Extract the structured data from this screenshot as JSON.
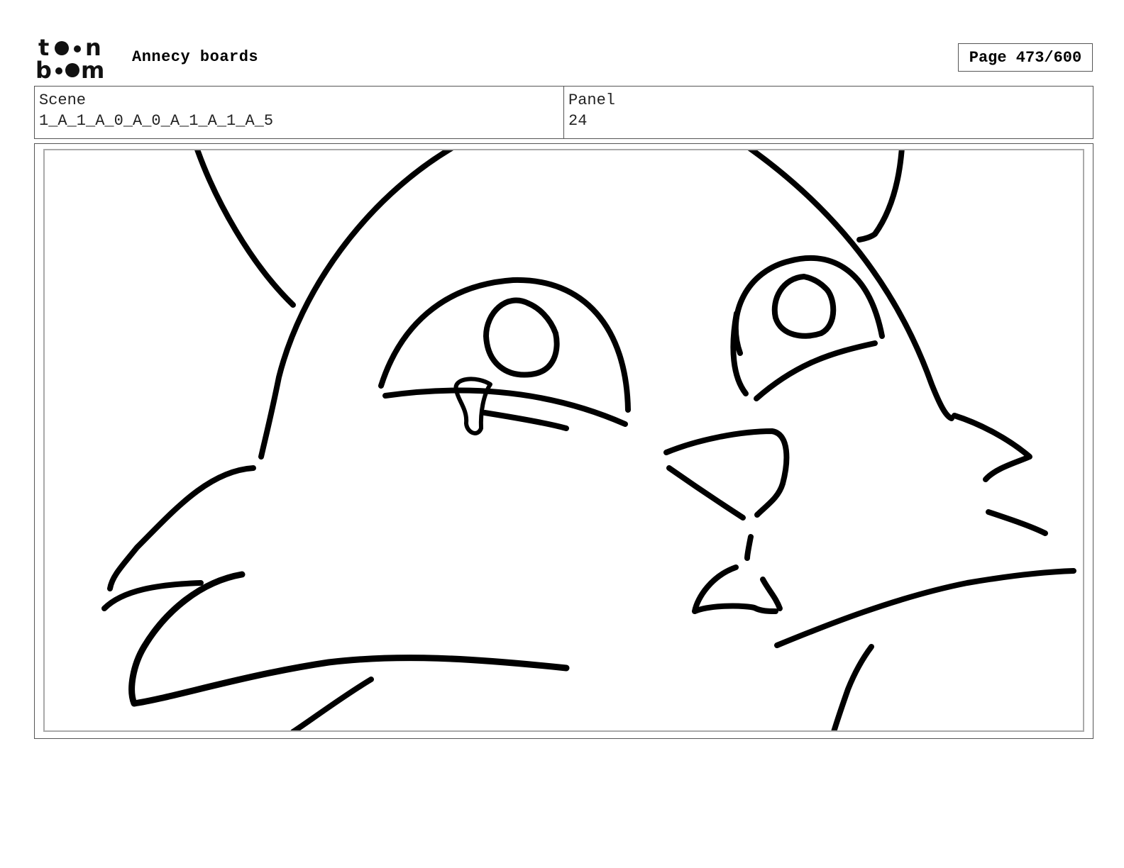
{
  "header": {
    "logo_text_top": "toon",
    "logo_text_bottom": "boom",
    "title": "Annecy boards",
    "page_label": "Page 473/600"
  },
  "info": {
    "scene_label": "Scene",
    "scene_value": "1_A_1_A_0_A_0_A_1_A_1_A_5",
    "panel_label": "Panel",
    "panel_value": "24"
  },
  "panel": {
    "content": "sketch"
  }
}
